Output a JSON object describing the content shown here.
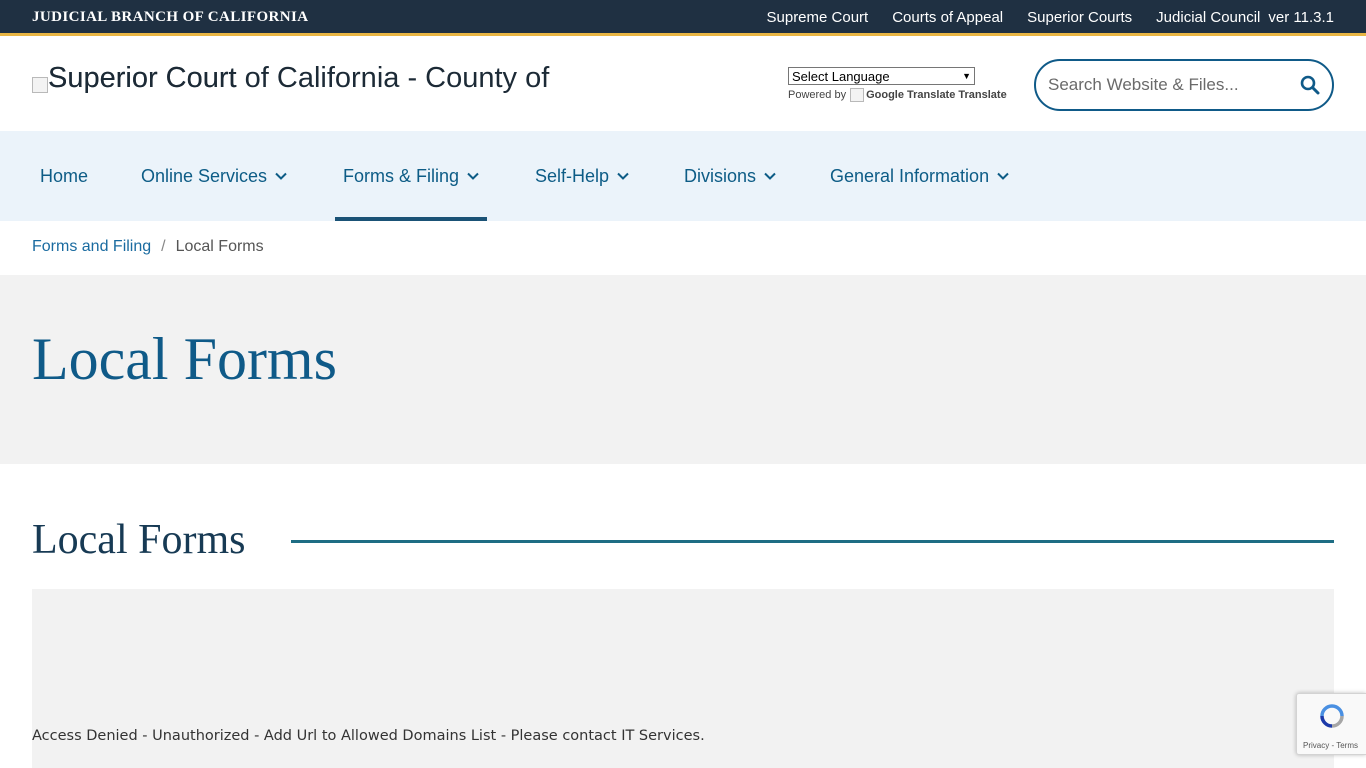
{
  "topbar": {
    "brand": "JUDICIAL BRANCH OF CALIFORNIA",
    "links": [
      "Supreme Court",
      "Courts of Appeal",
      "Superior Courts",
      "Judicial Council"
    ],
    "version": "ver 11.3.1"
  },
  "header": {
    "logo_alt_text_1": "Superior Court of California - County of",
    "logo_alt_text_2": "Superior Court",
    "language_select": {
      "selected": "Select Language"
    },
    "powered_by": "Powered by",
    "google_translate_alt": "Google Translate",
    "translate_label": "Translate",
    "search": {
      "placeholder": "Search Website & Files..."
    }
  },
  "nav": {
    "items": [
      {
        "label": "Home"
      },
      {
        "label": "Online Services"
      },
      {
        "label": "Forms & Filing"
      },
      {
        "label": "Self-Help"
      },
      {
        "label": "Divisions"
      },
      {
        "label": "General Information"
      }
    ],
    "active": "Forms & Filing"
  },
  "breadcrumb": {
    "parent": "Forms and Filing",
    "separator": "/",
    "current": "Local Forms"
  },
  "hero": {
    "title": "Local Forms"
  },
  "section": {
    "title": "Local Forms",
    "message": "Access Denied - Unauthorized - Add Url to Allowed Domains List - Please contact IT Services."
  },
  "recaptcha": {
    "privacy": "Privacy",
    "terms": "Terms"
  },
  "colors": {
    "topbar_bg": "#1f3042",
    "topbar_accent": "#e8b543",
    "primary": "#0f5a88",
    "nav_bg": "#ebf3fa",
    "hero_bg": "#f2f2f2"
  }
}
